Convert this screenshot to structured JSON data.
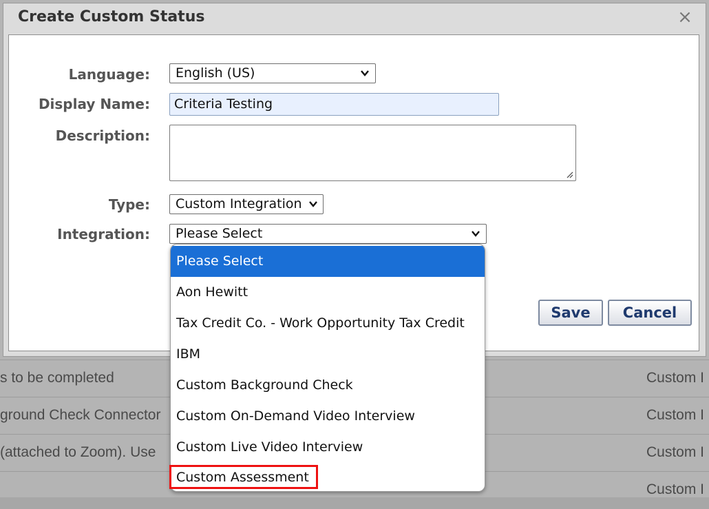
{
  "background": {
    "rows": [
      {
        "left": "s to be completed",
        "right": "Custom I"
      },
      {
        "left": "ground Check Connector",
        "right": "Custom I"
      },
      {
        "left": "(attached to Zoom). Use",
        "right": "Custom I"
      },
      {
        "left": "",
        "right": "Custom I"
      }
    ]
  },
  "dialog": {
    "title": "Create Custom Status",
    "close_icon": "×",
    "language_label": "Language:",
    "language_value": "English (US)",
    "display_name_label": "Display Name:",
    "display_name_value": "Criteria Testing",
    "description_label": "Description:",
    "description_value": "",
    "type_label": "Type:",
    "type_value": "Custom Integration",
    "integration_label": "Integration:",
    "integration_value": "Please Select",
    "save_label": "Save",
    "cancel_label": "Cancel"
  },
  "integration_options": [
    {
      "label": "Please Select",
      "selected": true
    },
    {
      "label": "Aon Hewitt",
      "selected": false
    },
    {
      "label": "Tax Credit Co. - Work Opportunity Tax Credit",
      "selected": false
    },
    {
      "label": "IBM",
      "selected": false
    },
    {
      "label": "Custom Background Check",
      "selected": false
    },
    {
      "label": "Custom On-Demand Video Interview",
      "selected": false
    },
    {
      "label": "Custom Live Video Interview",
      "selected": false
    },
    {
      "label": "Custom Assessment",
      "selected": false,
      "highlighted": true
    }
  ],
  "colors": {
    "selected_option_bg": "#1a6fd6",
    "highlight_border": "#e11111",
    "button_text": "#1f3a6e"
  }
}
